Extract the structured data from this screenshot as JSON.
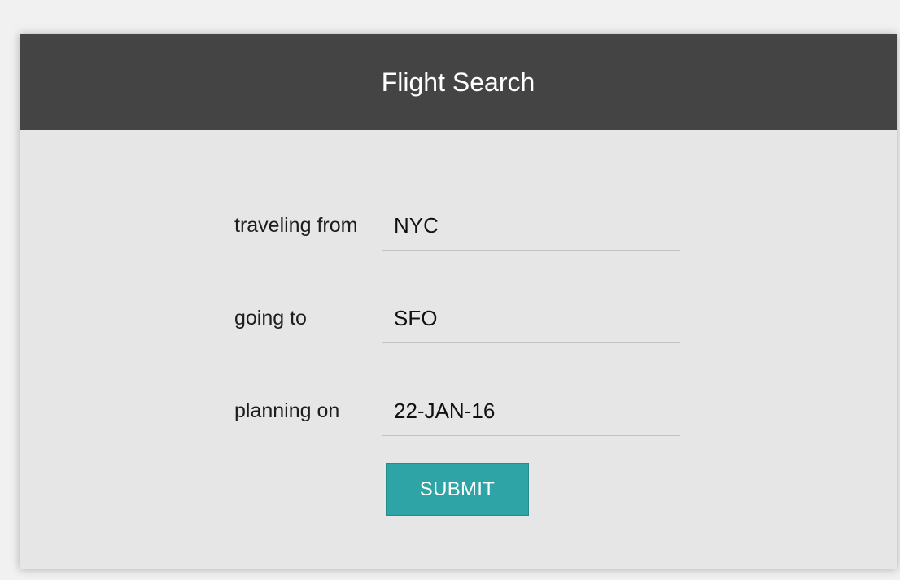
{
  "header": {
    "title": "Flight Search"
  },
  "form": {
    "from": {
      "label": "traveling from",
      "value": "NYC"
    },
    "to": {
      "label": "going to",
      "value": "SFO"
    },
    "date": {
      "label": "planning on",
      "value": "22-JAN-16"
    },
    "submit_label": "SUBMIT"
  },
  "colors": {
    "header_bg": "#454444",
    "card_bg": "#e6e6e6",
    "submit_bg": "#2ea4a6"
  }
}
